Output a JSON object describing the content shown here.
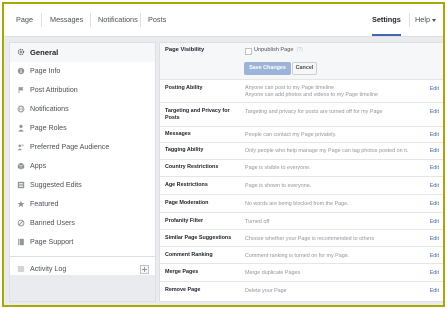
{
  "topnav": {
    "page": "Page",
    "messages": "Messages",
    "notifications": "Notifications",
    "posts": "Posts",
    "settings": "Settings",
    "help": "Help"
  },
  "sidebar": {
    "items": [
      {
        "label": "General",
        "icon": "gear-icon",
        "active": true
      },
      {
        "label": "Page Info",
        "icon": "info-icon"
      },
      {
        "label": "Post Attribution",
        "icon": "flag-icon"
      },
      {
        "label": "Notifications",
        "icon": "globe-icon"
      },
      {
        "label": "Page Roles",
        "icon": "person-icon"
      },
      {
        "label": "Preferred Page Audience",
        "icon": "people-icon"
      },
      {
        "label": "Apps",
        "icon": "cube-icon"
      },
      {
        "label": "Suggested Edits",
        "icon": "list-icon"
      },
      {
        "label": "Featured",
        "icon": "star-icon"
      },
      {
        "label": "Banned Users",
        "icon": "ban-icon"
      },
      {
        "label": "Page Support",
        "icon": "book-icon"
      }
    ],
    "activity_log": "Activity Log"
  },
  "general": {
    "page_visibility": {
      "label": "Page Visibility",
      "checkbox_label": "Unpublish Page",
      "help": "(?)",
      "save": "Save Changes",
      "cancel": "Cancel"
    },
    "edit": "Edit",
    "rows": [
      {
        "label": "Posting Ability",
        "value1": "Anyone can post to my Page timeline",
        "value2": "Anyone can add photos and videos to my Page timeline"
      },
      {
        "label": "Targeting and Privacy for Posts",
        "value1": "Targeting and privacy for posts are turned off for my Page"
      },
      {
        "label": "Messages",
        "value1": "People can contact my Page privately."
      },
      {
        "label": "Tagging Ability",
        "value1": "Only people who help manage my Page can tag photos posted on it."
      },
      {
        "label": "Country Restrictions",
        "value1": "Page is visible to everyone."
      },
      {
        "label": "Age Restrictions",
        "value1": "Page is shown to everyone."
      },
      {
        "label": "Page Moderation",
        "value1": "No words are being blocked from the Page."
      },
      {
        "label": "Profanity Filter",
        "value1": "Turned off"
      },
      {
        "label": "Similar Page Suggestions",
        "value1": "Choose whether your Page is recommended to others"
      },
      {
        "label": "Comment Ranking",
        "value1": "Comment ranking is turned on for my Page."
      },
      {
        "label": "Merge Pages",
        "value1": "Merge duplicate Pages"
      },
      {
        "label": "Remove Page",
        "value1": "Delete your Page"
      }
    ]
  },
  "colors": {
    "accent": "#4267b2",
    "frame_border": "#a8a800",
    "background": "#e9ebee"
  }
}
